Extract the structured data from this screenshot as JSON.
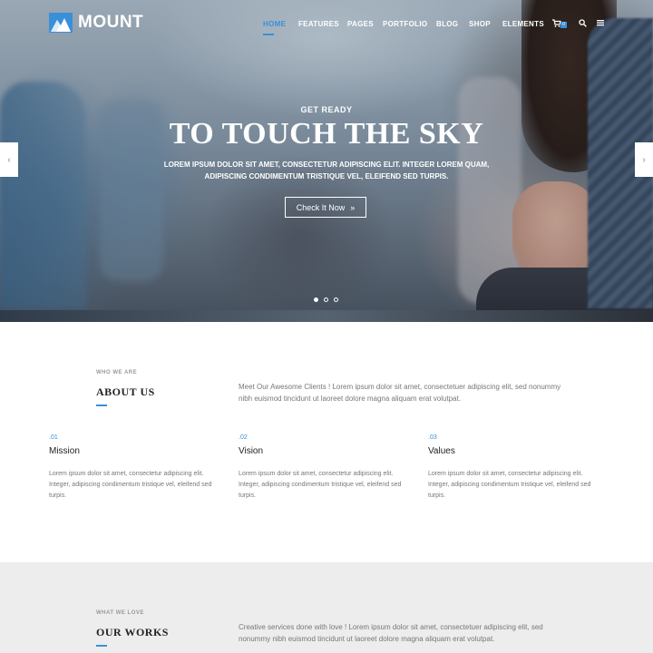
{
  "brand": {
    "name": "MOUNT",
    "accent": "#3a8fd9"
  },
  "nav": {
    "items": [
      "HOME",
      "FEATURES",
      "PAGES",
      "PORTFOLIO",
      "BLOG",
      "SHOP",
      "ELEMENTS"
    ],
    "active": "HOME",
    "cart_count": "0",
    "icons": [
      "cart-icon",
      "search-icon",
      "menu-icon"
    ]
  },
  "hero": {
    "kicker": "GET READY",
    "title": "TO TOUCH THE SKY",
    "subtitle_line1": "LOREM IPSUM DOLOR SIT AMET, CONSECTETUR ADIPISCING ELIT. INTEGER LOREM QUAM,",
    "subtitle_line2": "ADIPISCING CONDIMENTUM TRISTIQUE VEL, ELEIFEND SED TURPIS.",
    "button_label": "Check It Now",
    "button_icon": "double-chevron-right-icon",
    "slides": 3,
    "active_slide": 1
  },
  "about": {
    "kicker": "WHO WE ARE",
    "title": "ABOUT US",
    "desc_line1": "Meet Our Awesome Clients ! Lorem ipsum dolor sit amet, consectetuer adipiscing elit, sed nonummy",
    "desc_line2": "nibh euismod tincidunt ut laoreet dolore magna aliquam erat volutpat.",
    "features": [
      {
        "num": ".01",
        "title": "Mission",
        "text1": "Lorem ipsum dolor sit amet, consectetur adipiscing elit.",
        "text2": "Integer, adipiscing condimentum tristique vel, eleifend sed",
        "text3": "turpis."
      },
      {
        "num": ".02",
        "title": "Vision",
        "text1": "Lorem ipsum dolor sit amet, consectetur adipiscing elit.",
        "text2": "Integer, adipiscing condimentum tristique vel, eleifend sed",
        "text3": "turpis."
      },
      {
        "num": ".03",
        "title": "Values",
        "text1": "Lorem ipsum dolor sit amet, consectetur adipiscing elit.",
        "text2": "Integer, adipiscing condimentum tristique vel, eleifend sed",
        "text3": "turpis."
      }
    ]
  },
  "works": {
    "kicker": "WHAT WE LOVE",
    "title": "OUR WORKS",
    "desc_line1": "Creative services done with love ! Lorem ipsum dolor sit amet, consectetuer adipiscing elit, sed",
    "desc_line2": "nonummy nibh euismod tincidunt ut laoreet dolore magna aliquam erat volutpat."
  }
}
